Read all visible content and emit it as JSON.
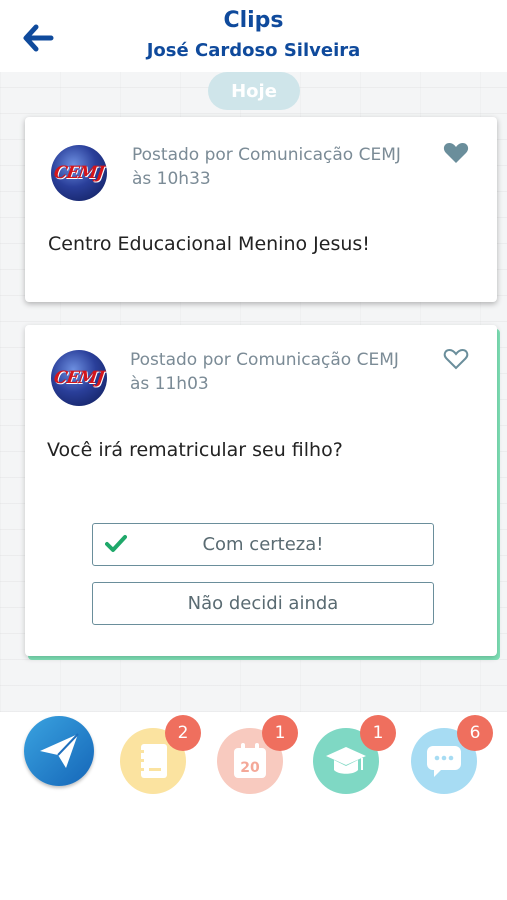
{
  "header": {
    "title": "Clips",
    "subtitle": "José Cardoso Silveira"
  },
  "feed": {
    "date_label": "Hoje",
    "posts": [
      {
        "avatar_text": "CEMJ",
        "posted_by": "Postado por Comunicação CEMJ",
        "time": "às 10h33",
        "message": "Centro Educacional Menino Jesus!",
        "liked": true
      },
      {
        "avatar_text": "CEMJ",
        "posted_by": "Postado por Comunicação CEMJ",
        "time": "às 11h03",
        "message": "Você irá rematricular seu filho?",
        "liked": false,
        "options": [
          {
            "label": "Com certeza!",
            "selected": true
          },
          {
            "label": "Não decidi ainda",
            "selected": false
          }
        ]
      }
    ]
  },
  "bottom_nav": {
    "items": [
      {
        "icon": "paper-plane-icon",
        "badge": null
      },
      {
        "icon": "notebook-icon",
        "badge": "2"
      },
      {
        "icon": "calendar-icon",
        "badge": "1",
        "calendar_day": "20"
      },
      {
        "icon": "graduation-cap-icon",
        "badge": "1"
      },
      {
        "icon": "chat-bubble-icon",
        "badge": "6"
      }
    ]
  },
  "colors": {
    "title": "#0f4a9c",
    "accent_green": "#7fe3b8",
    "badge": "#ef6f5e",
    "check": "#1fa86a"
  }
}
